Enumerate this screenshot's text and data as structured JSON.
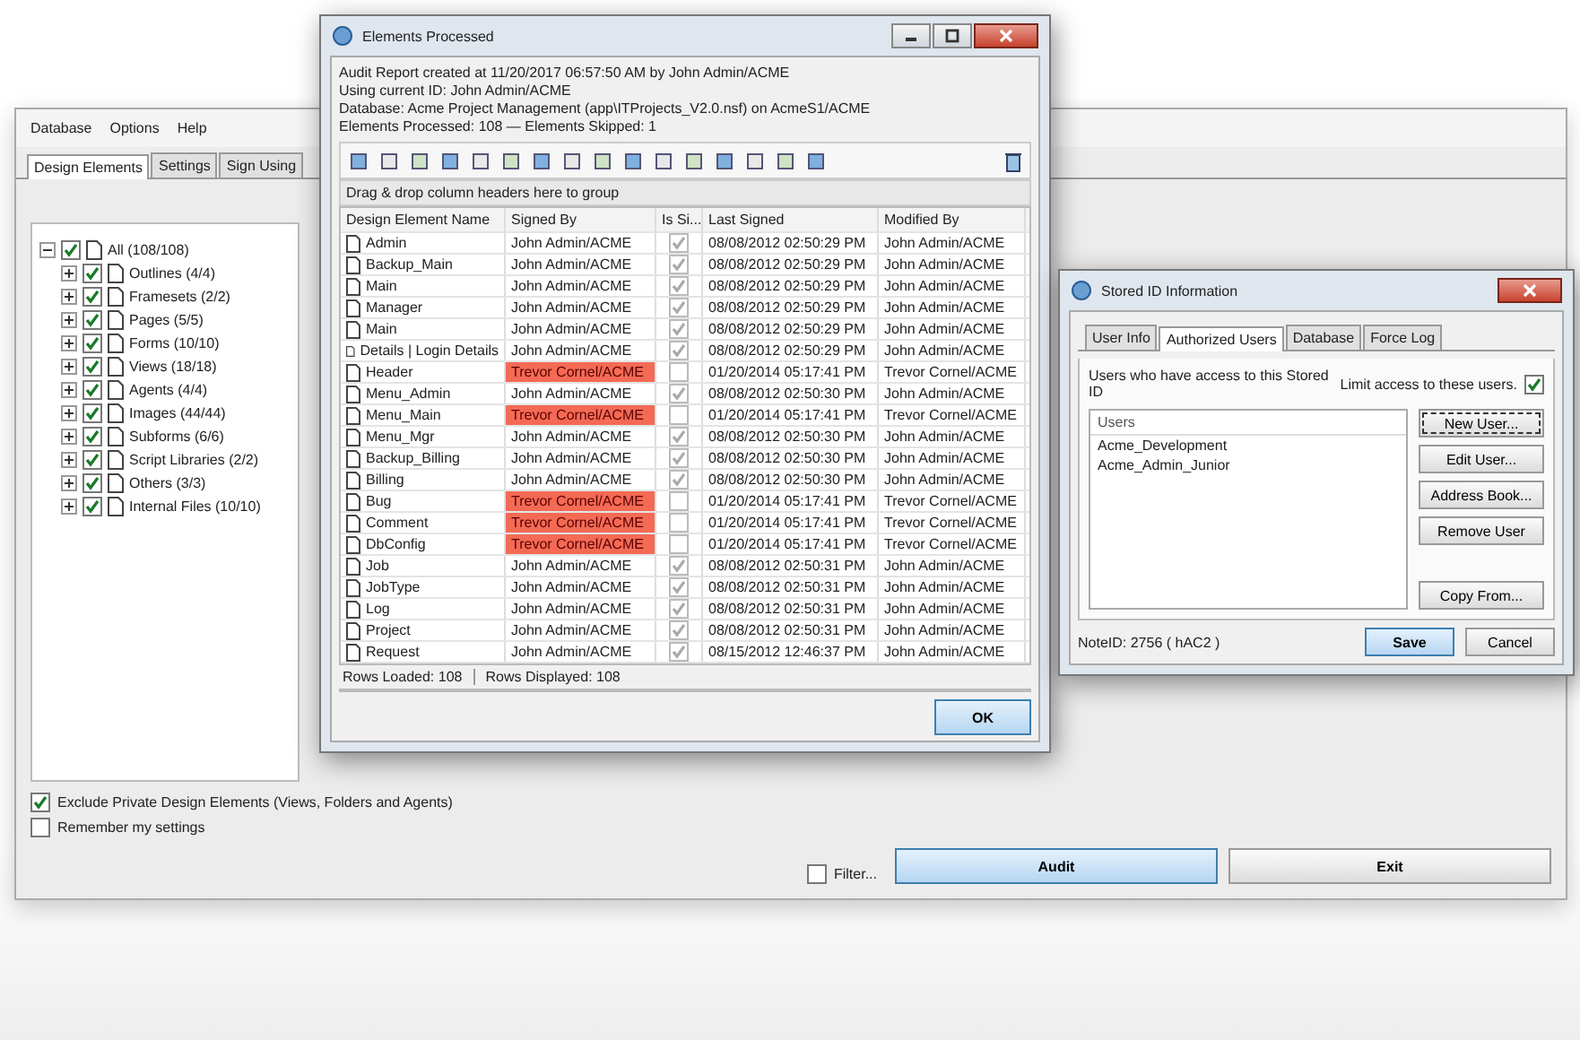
{
  "main_window": {
    "menu": [
      "Database",
      "Options",
      "Help"
    ],
    "tabs": [
      {
        "label": "Design Elements",
        "selected": true
      },
      {
        "label": "Settings",
        "selected": false
      },
      {
        "label": "Sign Using",
        "selected": false
      }
    ],
    "tree": {
      "label": "All (108/108)",
      "checked": true,
      "expanded": true,
      "children": [
        {
          "label": "Outlines (4/4)",
          "checked": true,
          "expanded": false
        },
        {
          "label": "Framesets (2/2)",
          "checked": true,
          "expanded": false
        },
        {
          "label": "Pages (5/5)",
          "checked": true,
          "expanded": false
        },
        {
          "label": "Forms (10/10)",
          "checked": true,
          "expanded": false
        },
        {
          "label": "Views (18/18)",
          "checked": true,
          "expanded": false
        },
        {
          "label": "Agents (4/4)",
          "checked": true,
          "expanded": false
        },
        {
          "label": "Images (44/44)",
          "checked": true,
          "expanded": false
        },
        {
          "label": "Subforms (6/6)",
          "checked": true,
          "expanded": false
        },
        {
          "label": "Script Libraries (2/2)",
          "checked": true,
          "expanded": false
        },
        {
          "label": "Others (3/3)",
          "checked": true,
          "expanded": false
        },
        {
          "label": "Internal Files (10/10)",
          "checked": true,
          "expanded": false
        }
      ]
    },
    "options": [
      {
        "label": "Exclude Private Design Elements (Views, Folders and Agents)",
        "checked": true
      },
      {
        "label": "Remember my settings",
        "checked": false
      }
    ],
    "filter": {
      "label": "Filter...",
      "checked": false
    },
    "buttons": [
      "Audit",
      "Exit"
    ]
  },
  "report_window": {
    "title": "Elements Processed",
    "info": [
      "Audit Report created at 11/20/2017 06:57:50 AM by John Admin/ACME",
      "Using current ID: John Admin/ACME",
      "Database: Acme Project Management (app\\ITProjects_V2.0.nsf) on AcmeS1/ACME",
      "Elements Processed: 108 — Elements Skipped: 1"
    ],
    "group_hint": "Drag & drop column headers here to group",
    "columns": [
      "Design Element Name",
      "Signed By",
      "Is Si...",
      "Last Signed",
      "Modified By"
    ],
    "rows": [
      {
        "name": "Admin",
        "signed_by": "John Admin/ACME",
        "flagged": false,
        "is_signed": true,
        "last_signed": "08/08/2012 02:50:29 PM",
        "modified_by": "John Admin/ACME"
      },
      {
        "name": "Backup_Main",
        "signed_by": "John Admin/ACME",
        "flagged": false,
        "is_signed": true,
        "last_signed": "08/08/2012 02:50:29 PM",
        "modified_by": "John Admin/ACME"
      },
      {
        "name": "Main",
        "signed_by": "John Admin/ACME",
        "flagged": false,
        "is_signed": true,
        "last_signed": "08/08/2012 02:50:29 PM",
        "modified_by": "John Admin/ACME"
      },
      {
        "name": "Manager",
        "signed_by": "John Admin/ACME",
        "flagged": false,
        "is_signed": true,
        "last_signed": "08/08/2012 02:50:29 PM",
        "modified_by": "John Admin/ACME"
      },
      {
        "name": "Main",
        "signed_by": "John Admin/ACME",
        "flagged": false,
        "is_signed": true,
        "last_signed": "08/08/2012 02:50:29 PM",
        "modified_by": "John Admin/ACME"
      },
      {
        "name": "Details | Login Details",
        "signed_by": "John Admin/ACME",
        "flagged": false,
        "is_signed": true,
        "last_signed": "08/08/2012 02:50:29 PM",
        "modified_by": "John Admin/ACME"
      },
      {
        "name": "Header",
        "signed_by": "Trevor Cornel/ACME",
        "flagged": true,
        "is_signed": false,
        "last_signed": "01/20/2014 05:17:41 PM",
        "modified_by": "Trevor Cornel/ACME"
      },
      {
        "name": "Menu_Admin",
        "signed_by": "John Admin/ACME",
        "flagged": false,
        "is_signed": true,
        "last_signed": "08/08/2012 02:50:30 PM",
        "modified_by": "John Admin/ACME"
      },
      {
        "name": "Menu_Main",
        "signed_by": "Trevor Cornel/ACME",
        "flagged": true,
        "is_signed": false,
        "last_signed": "01/20/2014 05:17:41 PM",
        "modified_by": "Trevor Cornel/ACME"
      },
      {
        "name": "Menu_Mgr",
        "signed_by": "John Admin/ACME",
        "flagged": false,
        "is_signed": true,
        "last_signed": "08/08/2012 02:50:30 PM",
        "modified_by": "John Admin/ACME"
      },
      {
        "name": "Backup_Billing",
        "signed_by": "John Admin/ACME",
        "flagged": false,
        "is_signed": true,
        "last_signed": "08/08/2012 02:50:30 PM",
        "modified_by": "John Admin/ACME"
      },
      {
        "name": "Billing",
        "signed_by": "John Admin/ACME",
        "flagged": false,
        "is_signed": true,
        "last_signed": "08/08/2012 02:50:30 PM",
        "modified_by": "John Admin/ACME"
      },
      {
        "name": "Bug",
        "signed_by": "Trevor Cornel/ACME",
        "flagged": true,
        "is_signed": false,
        "last_signed": "01/20/2014 05:17:41 PM",
        "modified_by": "Trevor Cornel/ACME"
      },
      {
        "name": "Comment",
        "signed_by": "Trevor Cornel/ACME",
        "flagged": true,
        "is_signed": false,
        "last_signed": "01/20/2014 05:17:41 PM",
        "modified_by": "Trevor Cornel/ACME"
      },
      {
        "name": "DbConfig",
        "signed_by": "Trevor Cornel/ACME",
        "flagged": true,
        "is_signed": false,
        "last_signed": "01/20/2014 05:17:41 PM",
        "modified_by": "Trevor Cornel/ACME"
      },
      {
        "name": "Job",
        "signed_by": "John Admin/ACME",
        "flagged": false,
        "is_signed": true,
        "last_signed": "08/08/2012 02:50:31 PM",
        "modified_by": "John Admin/ACME"
      },
      {
        "name": "JobType",
        "signed_by": "John Admin/ACME",
        "flagged": false,
        "is_signed": true,
        "last_signed": "08/08/2012 02:50:31 PM",
        "modified_by": "John Admin/ACME"
      },
      {
        "name": "Log",
        "signed_by": "John Admin/ACME",
        "flagged": false,
        "is_signed": true,
        "last_signed": "08/08/2012 02:50:31 PM",
        "modified_by": "John Admin/ACME"
      },
      {
        "name": "Project",
        "signed_by": "John Admin/ACME",
        "flagged": false,
        "is_signed": true,
        "last_signed": "08/08/2012 02:50:31 PM",
        "modified_by": "John Admin/ACME"
      },
      {
        "name": "Request",
        "signed_by": "John Admin/ACME",
        "flagged": false,
        "is_signed": true,
        "last_signed": "08/15/2012 12:46:37 PM",
        "modified_by": "John Admin/ACME"
      }
    ],
    "status": [
      "Rows Loaded: 108",
      "Rows Displayed: 108"
    ],
    "ok": "OK"
  },
  "dialog": {
    "title": "Stored ID Information",
    "tabs": [
      {
        "label": "User Info",
        "selected": false
      },
      {
        "label": "Authorized Users",
        "selected": true
      },
      {
        "label": "Database",
        "selected": false
      },
      {
        "label": "Force Log",
        "selected": false
      }
    ],
    "description": "Users who have access to this Stored ID",
    "limit": {
      "label": "Limit access to these users.",
      "checked": true
    },
    "list_header": "Users",
    "users": [
      "Acme_Development",
      "Acme_Admin_Junior"
    ],
    "side_buttons": [
      "New User...",
      "Edit User...",
      "Address Book...",
      "Remove User"
    ],
    "copy_button": "Copy From...",
    "note_id": "NoteID: 2756 ( hAC2 )",
    "buttons": [
      "Save",
      "Cancel"
    ]
  }
}
